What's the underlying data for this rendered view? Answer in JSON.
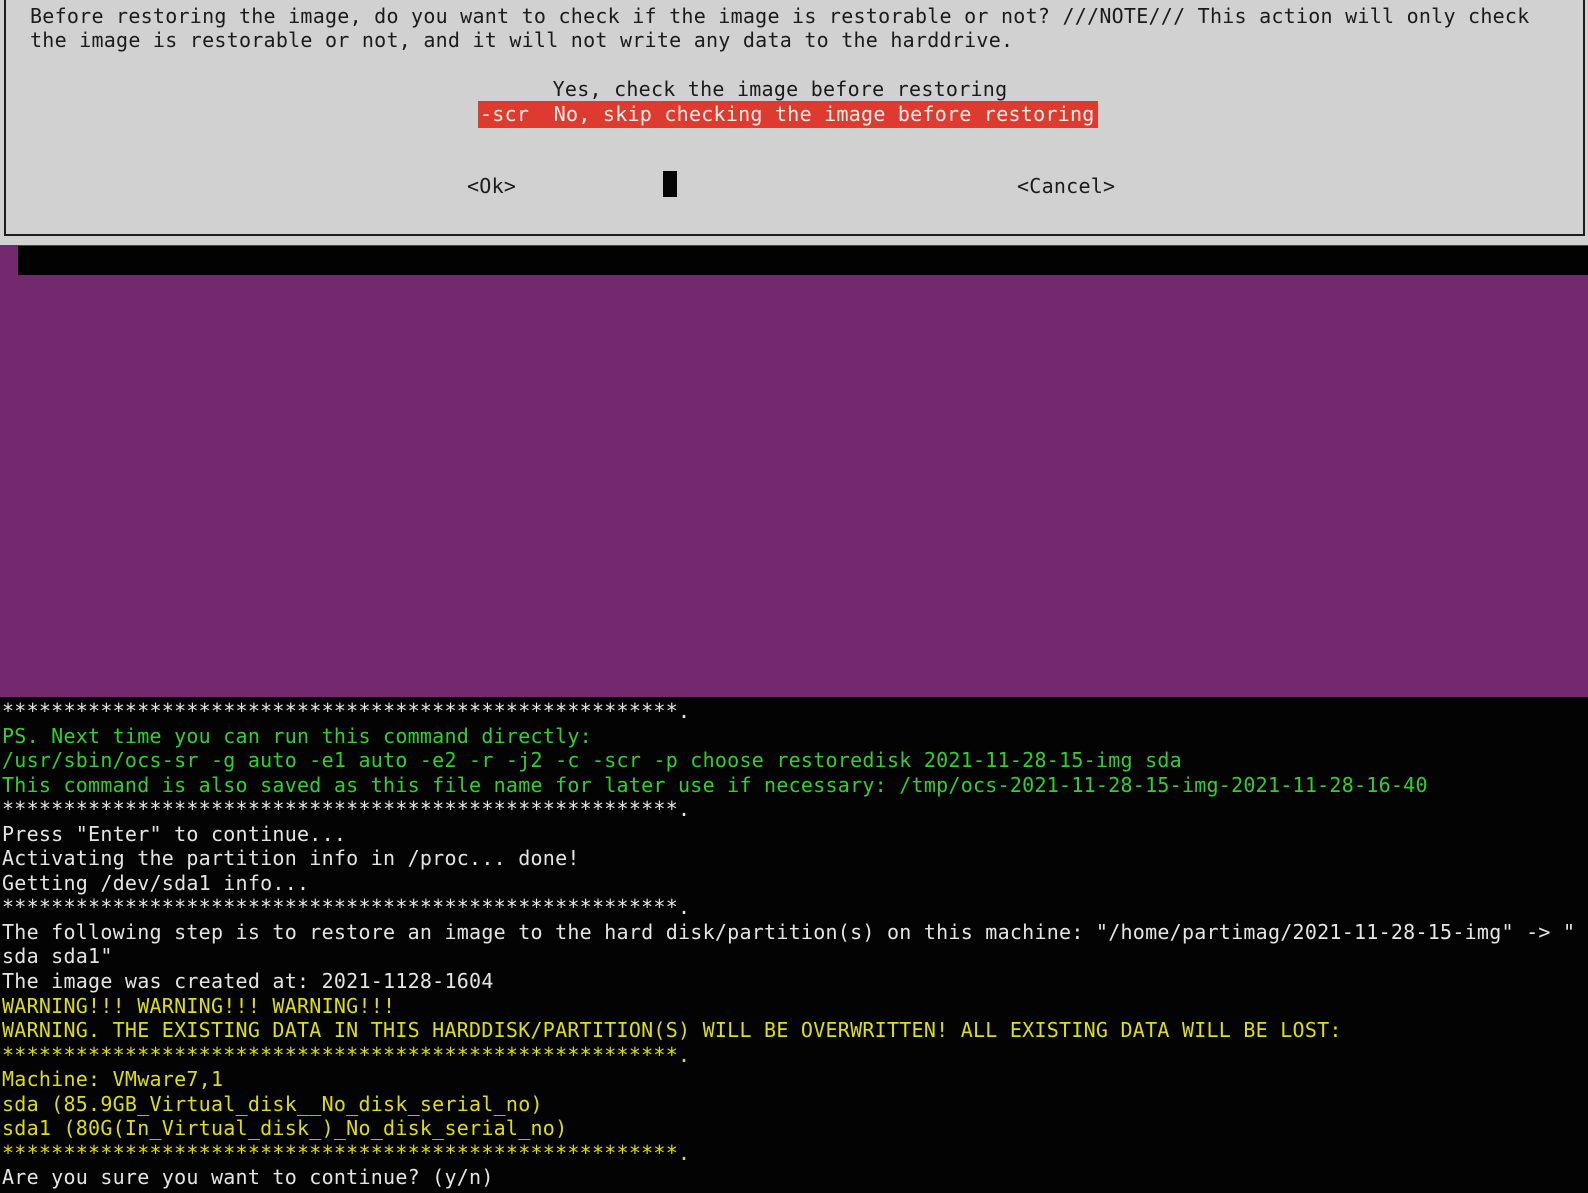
{
  "dialog": {
    "message_line1": "Before restoring the image, do you want to check if the image is restorable or not? ///NOTE/// This action will only check",
    "message_line2": "the image is restorable or not, and it will not write any data to the harddrive.",
    "options": [
      {
        "label": "Yes, check the image before restoring",
        "selected": false
      },
      {
        "label": "-scr  No, skip checking the image before restoring",
        "selected": true
      }
    ],
    "ok_label": "<Ok>",
    "cancel_label": "<Cancel>"
  },
  "terminal": {
    "lines": [
      {
        "text": "*******************************************************.",
        "color": "white"
      },
      {
        "text": "PS. Next time you can run this command directly:",
        "color": "green"
      },
      {
        "text": "/usr/sbin/ocs-sr -g auto -e1 auto -e2 -r -j2 -c -scr -p choose restoredisk 2021-11-28-15-img sda",
        "color": "green"
      },
      {
        "text": "This command is also saved as this file name for later use if necessary: /tmp/ocs-2021-11-28-15-img-2021-11-28-16-40",
        "color": "green"
      },
      {
        "text": "*******************************************************.",
        "color": "white"
      },
      {
        "text": "Press \"Enter\" to continue...",
        "color": "white"
      },
      {
        "text": "Activating the partition info in /proc... done!",
        "color": "white"
      },
      {
        "text": "Getting /dev/sda1 info...",
        "color": "white"
      },
      {
        "text": "*******************************************************.",
        "color": "white"
      },
      {
        "text": "The following step is to restore an image to the hard disk/partition(s) on this machine: \"/home/partimag/2021-11-28-15-img\" -> \"",
        "color": "white"
      },
      {
        "text": "sda sda1\"",
        "color": "white"
      },
      {
        "text": "The image was created at: 2021-1128-1604",
        "color": "white"
      },
      {
        "text": "WARNING!!! WARNING!!! WARNING!!!",
        "color": "yellow"
      },
      {
        "text": "WARNING. THE EXISTING DATA IN THIS HARDDISK/PARTITION(S) WILL BE OVERWRITTEN! ALL EXISTING DATA WILL BE LOST:",
        "color": "yellow"
      },
      {
        "text": "*******************************************************.",
        "color": "yellow"
      },
      {
        "text": "Machine: VMware7,1",
        "color": "yellow"
      },
      {
        "text": "sda (85.9GB_Virtual_disk__No_disk_serial_no)",
        "color": "yellow"
      },
      {
        "text": "sda1 (80G(In_Virtual_disk_)_No_disk_serial_no)",
        "color": "yellow"
      },
      {
        "text": "*******************************************************.",
        "color": "yellow"
      },
      {
        "text": "Are you sure you want to continue? (y/n)",
        "color": "white"
      }
    ]
  },
  "colors": {
    "desktop_purple": "#74296f",
    "dialog_gray": "#d1d1d1",
    "highlight_red": "#dd3b2f",
    "terminal_green": "#2fd02f",
    "terminal_yellow": "#dede12",
    "terminal_white": "#e4e4e4"
  }
}
